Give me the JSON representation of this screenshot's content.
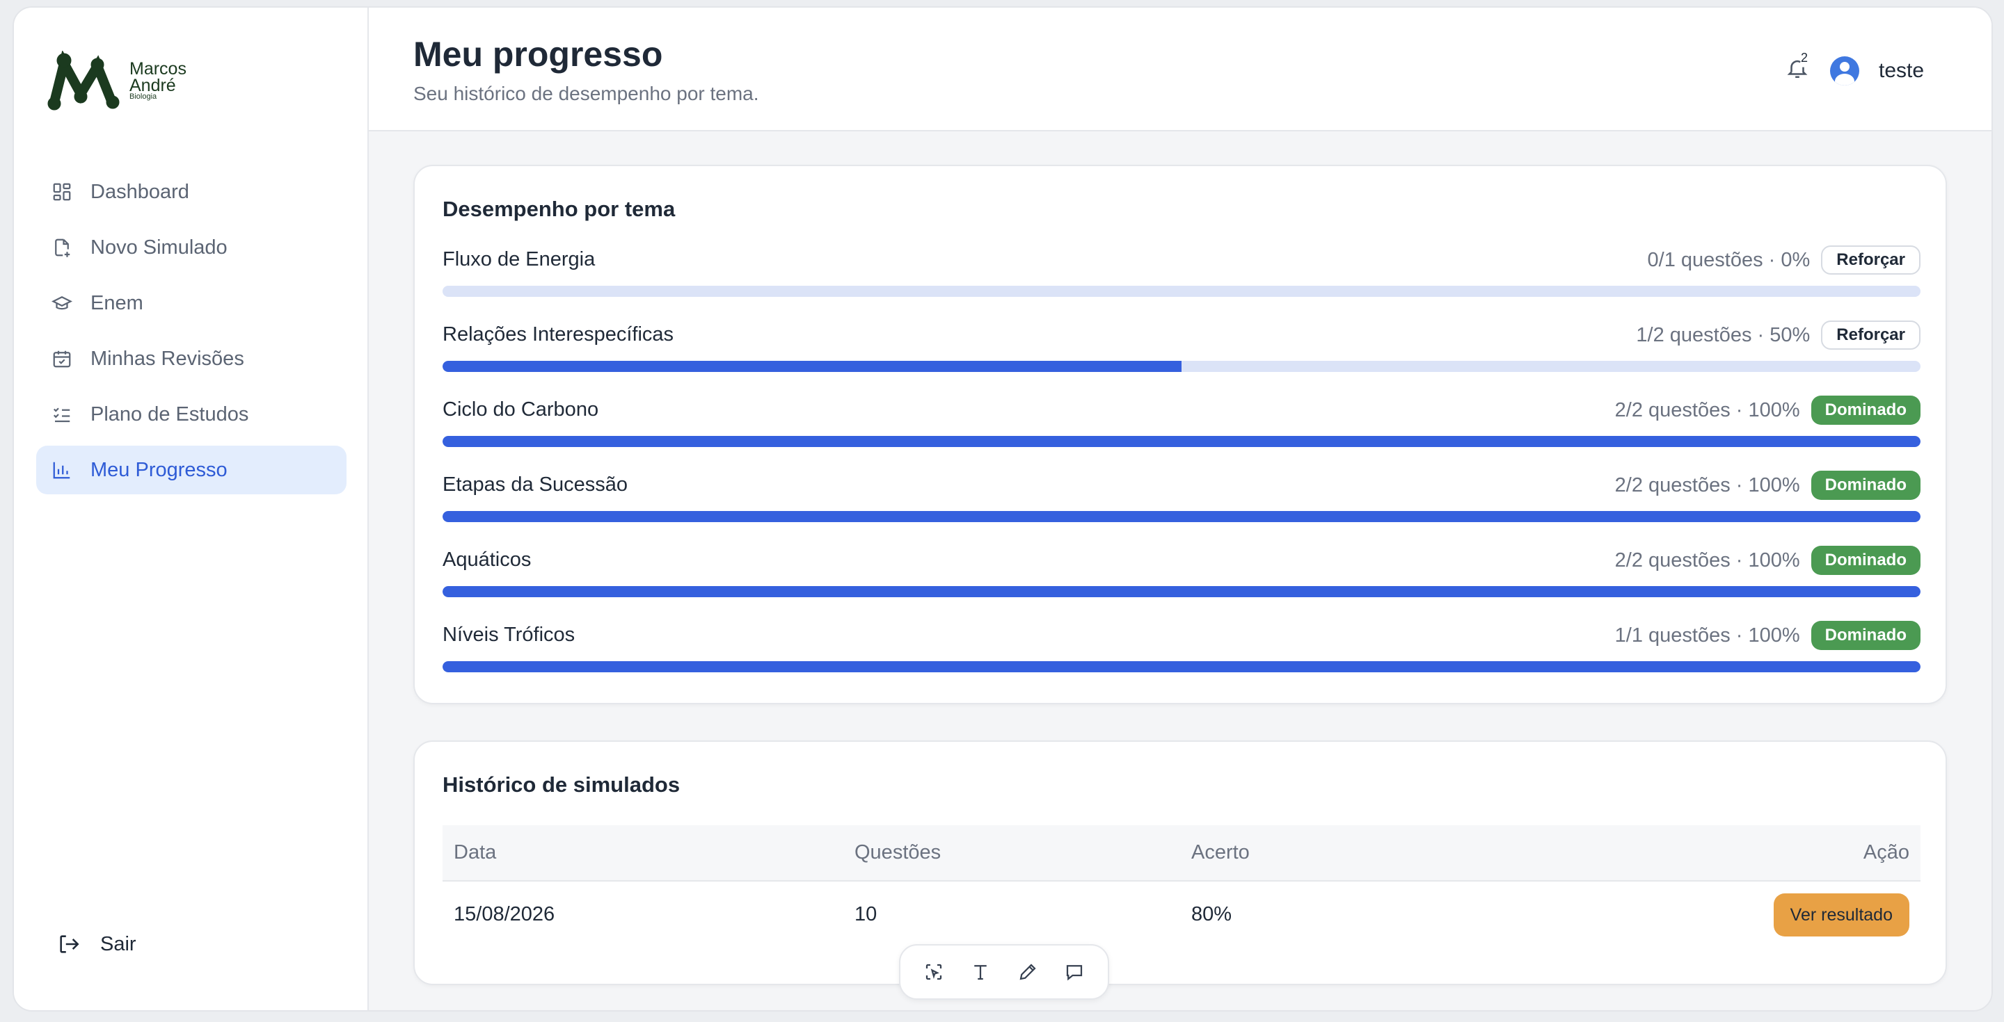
{
  "brand": {
    "name_line1": "Marcos",
    "name_line2": "André",
    "tagline": "Biologia",
    "color": "#1b3a1f"
  },
  "sidebar": {
    "items": [
      {
        "label": "Dashboard",
        "icon": "dashboard-icon",
        "active": false
      },
      {
        "label": "Novo Simulado",
        "icon": "new-file-icon",
        "active": false
      },
      {
        "label": "Enem",
        "icon": "graduation-cap-icon",
        "active": false
      },
      {
        "label": "Minhas Revisões",
        "icon": "calendar-check-icon",
        "active": false
      },
      {
        "label": "Plano de Estudos",
        "icon": "checklist-icon",
        "active": false
      },
      {
        "label": "Meu Progresso",
        "icon": "bar-chart-icon",
        "active": true
      }
    ],
    "logout_label": "Sair"
  },
  "header": {
    "title": "Meu progresso",
    "subtitle": "Seu histórico de desempenho por tema.",
    "notification_count": "2",
    "user_name": "teste"
  },
  "performance": {
    "title": "Desempenho por tema",
    "topics": [
      {
        "name": "Fluxo de Energia",
        "stats": "0/1 questões · 0%",
        "progress": 0,
        "status": "Reforçar"
      },
      {
        "name": "Relações Interespecíficas",
        "stats": "1/2 questões · 50%",
        "progress": 0.5,
        "status": "Reforçar"
      },
      {
        "name": "Ciclo do Carbono",
        "stats": "2/2 questões · 100%",
        "progress": 1,
        "status": "Dominado"
      },
      {
        "name": "Etapas da Sucessão",
        "stats": "2/2 questões · 100%",
        "progress": 1,
        "status": "Dominado"
      },
      {
        "name": "Aquáticos",
        "stats": "2/2 questões · 100%",
        "progress": 1,
        "status": "Dominado"
      },
      {
        "name": "Níveis Tróficos",
        "stats": "1/1 questões · 100%",
        "progress": 1,
        "status": "Dominado"
      }
    ]
  },
  "history": {
    "title": "Histórico de simulados",
    "columns": [
      "Data",
      "Questões",
      "Acerto",
      "Ação"
    ],
    "rows": [
      {
        "date": "15/08/2026",
        "questions": "10",
        "score": "80%",
        "action": "Ver resultado"
      }
    ]
  },
  "toolbar": {
    "tools": [
      "select-area-icon",
      "text-icon",
      "pencil-icon",
      "comment-icon"
    ]
  },
  "colors": {
    "accent": "#3560de",
    "track": "#dbe3f7",
    "success": "#4b9a52",
    "warning": "#e8a145",
    "active_bg": "#e3edfd"
  }
}
